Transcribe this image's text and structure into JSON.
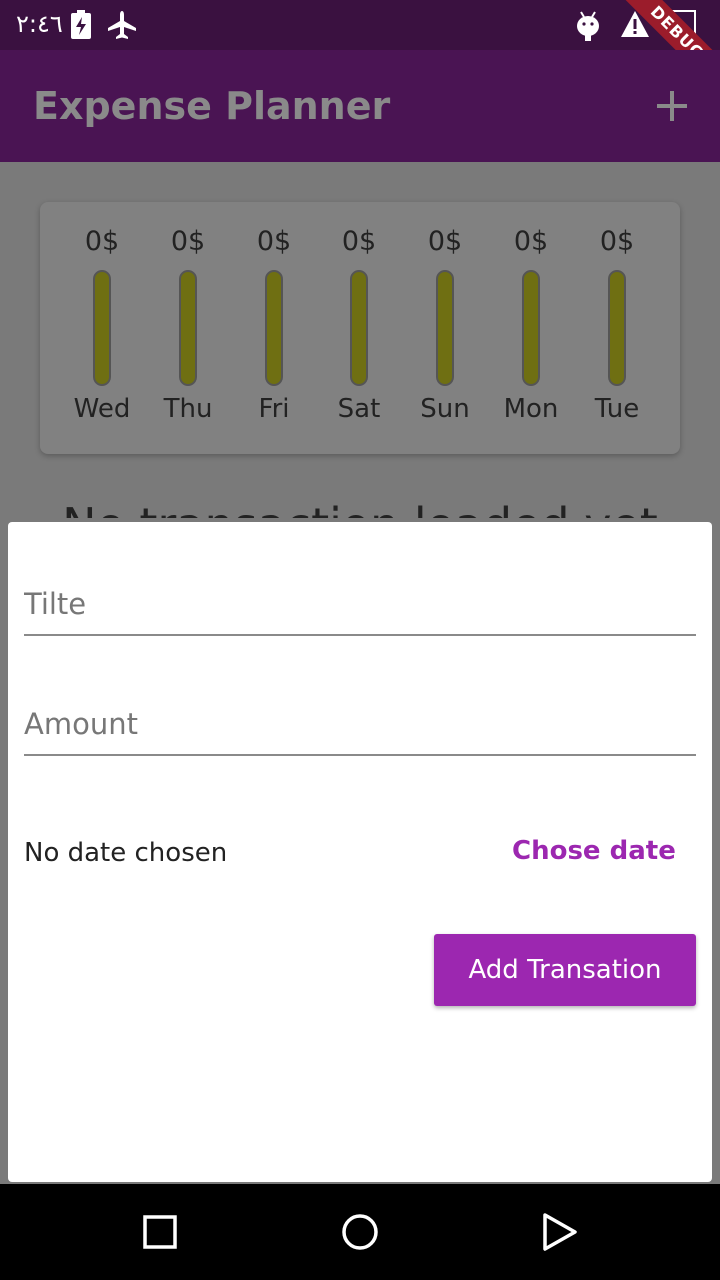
{
  "status_bar": {
    "time": "٢:٤٦",
    "debug_label": "DEBUG"
  },
  "app_bar": {
    "title": "Expense Planner"
  },
  "chart": {
    "bars": [
      {
        "day": "Wed",
        "amount": "0$",
        "fraction": 0
      },
      {
        "day": "Thu",
        "amount": "0$",
        "fraction": 0
      },
      {
        "day": "Fri",
        "amount": "0$",
        "fraction": 0
      },
      {
        "day": "Sat",
        "amount": "0$",
        "fraction": 0
      },
      {
        "day": "Sun",
        "amount": "0$",
        "fraction": 0
      },
      {
        "day": "Mon",
        "amount": "0$",
        "fraction": 0
      },
      {
        "day": "Tue",
        "amount": "0$",
        "fraction": 0
      }
    ]
  },
  "main": {
    "empty_message": "No transaction loaded yet"
  },
  "form": {
    "title_placeholder": "Tilte",
    "amount_placeholder": "Amount",
    "date_label": "No date chosen",
    "choose_date_label": "Chose date",
    "submit_label": "Add Transation"
  },
  "colors": {
    "accent": "#9c27b0",
    "app_bar": "#4a1453",
    "status_bar": "#3a1140"
  },
  "icons": {
    "status": [
      "battery-charging-icon",
      "airplane-icon",
      "android-icon",
      "warning-icon",
      "image-icon"
    ],
    "app_bar_action": "add-icon",
    "nav": [
      "recents-icon",
      "home-icon",
      "back-icon"
    ]
  }
}
